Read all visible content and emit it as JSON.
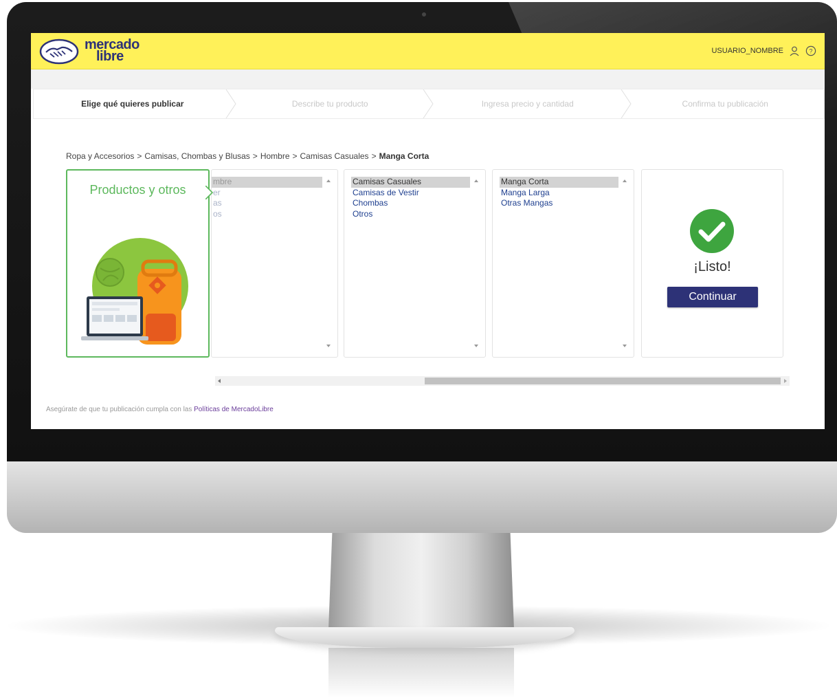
{
  "header": {
    "logo_line1": "mercado",
    "logo_line2": "libre",
    "username": "USUARIO_NOMBRE",
    "brand_yellow": "#fff159",
    "brand_blue": "#2d3277"
  },
  "steps": [
    {
      "label": "Elige qué quieres publicar",
      "active": true
    },
    {
      "label": "Describe tu producto",
      "active": false
    },
    {
      "label": "Ingresa precio y cantidad",
      "active": false
    },
    {
      "label": "Confirma tu publicación",
      "active": false
    }
  ],
  "breadcrumb": {
    "items": [
      "Ropa y Accesorios",
      "Camisas, Chombas y Blusas",
      "Hombre",
      "Camisas Casuales"
    ],
    "separator": ">",
    "current": "Manga Corta"
  },
  "category_tile": {
    "title": "Productos y otros",
    "accent": "#5cb85c"
  },
  "panels": [
    {
      "items": [
        "mbre",
        "er",
        "as",
        "os"
      ],
      "selected": 0
    },
    {
      "items": [
        "Camisas Casuales",
        "Camisas de Vestir",
        "Chombas",
        "Otros"
      ],
      "selected": 0
    },
    {
      "items": [
        "Manga Corta",
        "Manga Larga",
        "Otras Mangas"
      ],
      "selected": 0
    }
  ],
  "ready": {
    "text": "¡Listo!",
    "button": "Continuar",
    "icon": "check-circle-icon",
    "check_color": "#3ea53f"
  },
  "footer": {
    "text": "Asegúrate de que tu publicación cumpla con las",
    "link": "Políticas de MercadoLibre"
  }
}
